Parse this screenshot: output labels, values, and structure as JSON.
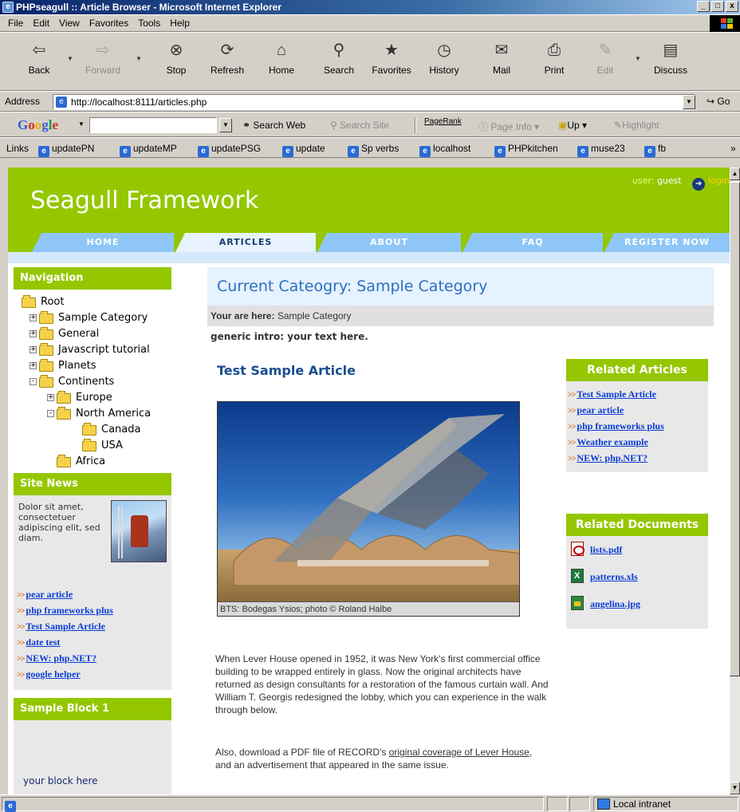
{
  "window": {
    "title": "PHPseagull :: Article Browser - Microsoft Internet Explorer",
    "buttons": [
      "_",
      "□",
      "x"
    ]
  },
  "menu": [
    "File",
    "Edit",
    "View",
    "Favorites",
    "Tools",
    "Help"
  ],
  "toolbar": {
    "buttons": [
      {
        "label": "Back",
        "icon": "back-arrow-icon",
        "enabled": true
      },
      {
        "label": "Forward",
        "icon": "forward-arrow-icon",
        "enabled": false
      },
      {
        "label": "Stop",
        "icon": "stop-icon",
        "enabled": true
      },
      {
        "label": "Refresh",
        "icon": "refresh-icon",
        "enabled": true
      },
      {
        "label": "Home",
        "icon": "home-icon",
        "enabled": true
      },
      {
        "label": "Search",
        "icon": "search-icon",
        "enabled": true
      },
      {
        "label": "Favorites",
        "icon": "favorites-icon",
        "enabled": true
      },
      {
        "label": "History",
        "icon": "history-icon",
        "enabled": true
      },
      {
        "label": "Mail",
        "icon": "mail-icon",
        "enabled": true
      },
      {
        "label": "Print",
        "icon": "print-icon",
        "enabled": true
      },
      {
        "label": "Edit",
        "icon": "edit-icon",
        "enabled": false
      },
      {
        "label": "Discuss",
        "icon": "discuss-icon",
        "enabled": true
      }
    ]
  },
  "address": {
    "label": "Address",
    "url": "http://localhost:8111/articles.php",
    "go_label": "Go"
  },
  "google_bar": {
    "logo": "Google",
    "search_web": "Search Web",
    "search_site": "Search Site",
    "pagerank": "PageRank",
    "page_info": "Page Info",
    "up": "Up",
    "highlight": "Highlight"
  },
  "links_bar": {
    "label": "Links",
    "items": [
      "updatePN",
      "updateMP",
      "updatePSG",
      "update",
      "Sp verbs",
      "localhost",
      "PHPkitchen",
      "muse23",
      "fb"
    ]
  },
  "site": {
    "title": "Seagull Framework",
    "user_label": "user:",
    "user_value": "guest",
    "login_label": "login",
    "tabs": [
      "HOME",
      "ARTICLES",
      "ABOUT",
      "FAQ",
      "REGISTER NOW"
    ],
    "active_tab": "ARTICLES"
  },
  "navigation": {
    "title": "Navigation",
    "tree": [
      {
        "label": "Root",
        "depth": 0,
        "toggle": ""
      },
      {
        "label": "Sample Category",
        "depth": 1,
        "toggle": "+"
      },
      {
        "label": "General",
        "depth": 1,
        "toggle": "+"
      },
      {
        "label": "Javascript tutorial",
        "depth": 1,
        "toggle": "+"
      },
      {
        "label": "Planets",
        "depth": 1,
        "toggle": "+"
      },
      {
        "label": "Continents",
        "depth": 1,
        "toggle": "-"
      },
      {
        "label": "Europe",
        "depth": 2,
        "toggle": "+"
      },
      {
        "label": "North America",
        "depth": 2,
        "toggle": "-"
      },
      {
        "label": "Canada",
        "depth": 3,
        "toggle": ""
      },
      {
        "label": "USA",
        "depth": 3,
        "toggle": ""
      },
      {
        "label": "Africa",
        "depth": 2,
        "toggle": ""
      }
    ]
  },
  "site_news": {
    "title": "Site News",
    "text": "Dolor sit amet, consectetuer adipiscing elit, sed diam.",
    "links": [
      "pear article",
      "php frameworks plus",
      "Test Sample Article",
      "date test",
      "NEW: php.NET?",
      "google helper"
    ]
  },
  "sample_block": {
    "title": "Sample Block 1",
    "text": "your block here"
  },
  "main": {
    "category_heading": "Current Cateogry: Sample Category",
    "breadcrumb_label": "Your are here:",
    "breadcrumb_value": "Sample Category",
    "intro": "generic intro: your text here.",
    "article_title": "Test Sample Article",
    "photo_caption": "BTS: Bodegas Ysios;  photo © Roland Halbe",
    "paragraph1": "When Lever House opened in 1952, it was New York's first commercial office building to be wrapped entirely in glass. Now the original architects have returned as design consultants for a restoration of the famous curtain wall. And William T. Georgis redesigned the lobby, which you can experience in the walk through below.",
    "paragraph2_before": "Also, download a PDF file of RECORD's ",
    "paragraph2_link": "original coverage of Lever House",
    "paragraph2_after": ", and an advertisement that appeared in the same issue."
  },
  "related_articles": {
    "title": "Related Articles",
    "links": [
      "Test Sample Article",
      "pear article",
      "php frameworks plus",
      "Weather example",
      "NEW: php.NET?"
    ]
  },
  "related_documents": {
    "title": "Related Documents",
    "docs": [
      {
        "name": "lists.pdf",
        "icon": "pdf-file-icon"
      },
      {
        "name": "patterns.xls",
        "icon": "excel-file-icon"
      },
      {
        "name": "angelina.jpg",
        "icon": "image-file-icon"
      }
    ]
  },
  "status_bar": {
    "zone": "Local intranet"
  },
  "colors": {
    "header_green": "#94c700",
    "tab_blue": "#8ec6f7",
    "link_blue": "#0a3cd6",
    "category_bar": "#e6f2ff"
  }
}
